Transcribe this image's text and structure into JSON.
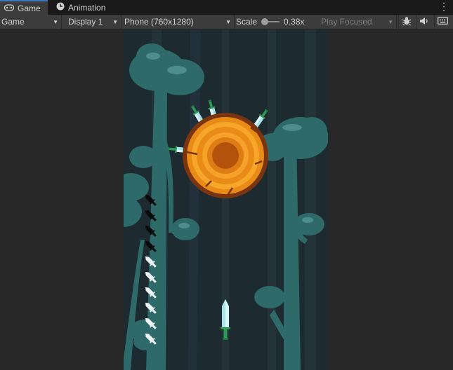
{
  "tabs": [
    {
      "label": "Game",
      "icon": "gamepad-icon",
      "active": true
    },
    {
      "label": "Animation",
      "icon": "animation-clock-icon",
      "active": false
    }
  ],
  "toolbar": {
    "view_mode": "Game",
    "display": "Display 1",
    "resolution": "Phone (760x1280)",
    "scale_label": "Scale",
    "scale_value": "0.38x",
    "play_mode": "Play Focused",
    "icons": [
      "bug-icon",
      "speaker-icon",
      "keyboard-icon"
    ]
  },
  "game": {
    "knives_remaining": 6,
    "knives_used": 4,
    "knives_stuck_in_target": 4,
    "colors": {
      "background": "#1d2a30",
      "trees": "#2e6a6a",
      "log_outer": "#7a3410",
      "log_mid": "#e98b17",
      "log_core": "#b4520c",
      "blade": "#d9f6f8",
      "handle": "#2e9a55"
    }
  }
}
